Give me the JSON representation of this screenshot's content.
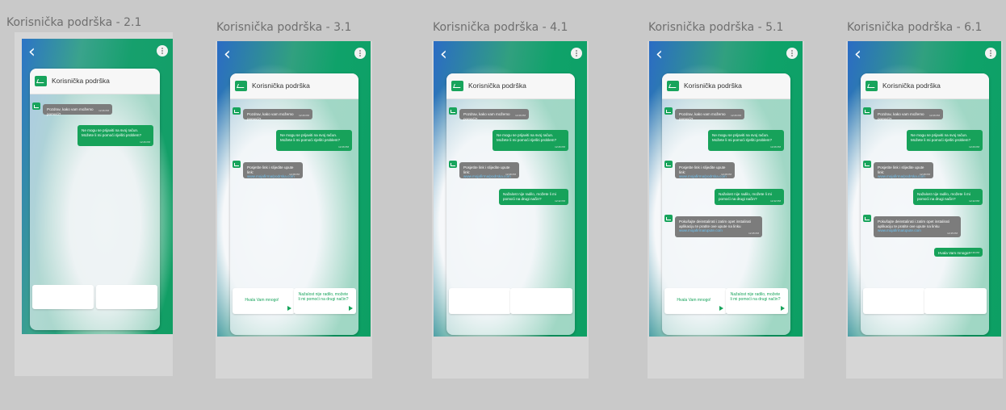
{
  "app": {
    "chat_title": "Korisnička podrška",
    "back_symbol": "‹",
    "nav_icons": [
      "home-icon",
      "walking-person-icon",
      "dog-icon",
      "pet-icon"
    ],
    "colors": {
      "accent_green": "#17a25a",
      "bot_gray": "#7c7c7c",
      "link_blue": "#6ec3f2",
      "canvas": "#c9c9c9"
    }
  },
  "frames": [
    {
      "title": "Korisnička podrška - 2.1",
      "messages": [
        {
          "from": "bot",
          "text": "Pozdrav, kako vam možemo pomoći?",
          "time": "12:26 PM"
        },
        {
          "from": "user",
          "text": "Ne mogu se prijaviti na svoj račun. Možete li mi pomoći riješiti problem?",
          "time": "12:26 PM"
        }
      ],
      "replies": [
        "",
        ""
      ]
    },
    {
      "title": "Korisnička podrška - 3.1",
      "messages": [
        {
          "from": "bot",
          "text": "Pozdrav, kako vam možemo pomoći?",
          "time": "12:26 PM"
        },
        {
          "from": "user",
          "text": "Ne mogu se prijaviti na svoj račun. Možete li mi pomoći riješiti problem?",
          "time": "12:26 PM"
        },
        {
          "from": "bot",
          "text": "Posjetite link i slijedite upute link:",
          "link": "www.mojafirma/podrska.com",
          "time": "12:28 PM"
        }
      ],
      "replies": [
        "Hvala Vam mnogo!",
        "Nažalost nije radilo, možete li mi pomoći na drugi način?"
      ]
    },
    {
      "title": "Korisnička podrška - 4.1",
      "messages": [
        {
          "from": "bot",
          "text": "Pozdrav, kako vam možemo pomoći?",
          "time": "12:26 PM"
        },
        {
          "from": "user",
          "text": "Ne mogu se prijaviti na svoj račun. Možete li mi pomoći riješiti problem?",
          "time": "12:26 PM"
        },
        {
          "from": "bot",
          "text": "Posjetite link i slijedite upute link:",
          "link": "www.mojafirma/podrska.com",
          "time": "12:28 PM"
        },
        {
          "from": "user",
          "text": "Nažalost nije radilo, možete li mi pomoći na drugi način?",
          "time": "12:42 PM"
        }
      ],
      "replies": [
        "",
        ""
      ]
    },
    {
      "title": "Korisnička podrška - 5.1",
      "messages": [
        {
          "from": "bot",
          "text": "Pozdrav, kako vam možemo pomoći?",
          "time": "12:26 PM"
        },
        {
          "from": "user",
          "text": "Ne mogu se prijaviti na svoj račun. Možete li mi pomoći riješiti problem?",
          "time": "12:26 PM"
        },
        {
          "from": "bot",
          "text": "Posjetite link i slijedite upute link:",
          "link": "www.mojafirma/podrska.com",
          "time": "12:28 PM"
        },
        {
          "from": "user",
          "text": "Nažalost nije radilo, možete li mi pomoći na drugi način?",
          "time": "12:42 PM"
        },
        {
          "from": "bot",
          "text": "Pokušajte deinstalirati i zatim opet instalirati aplikaciju te pratite ove upute na linku",
          "link": "www.mojafirma/upute.com",
          "time": "12:45 PM"
        }
      ],
      "replies": [
        "Hvala Vam mnogo!",
        "Nažalost nije radilo, možete li mi pomoći na drugi način?"
      ]
    },
    {
      "title": "Korisnička podrška - 6.1",
      "messages": [
        {
          "from": "bot",
          "text": "Pozdrav, kako vam možemo pomoći?",
          "time": "12:26 PM"
        },
        {
          "from": "user",
          "text": "Ne mogu se prijaviti na svoj račun. Možete li mi pomoći riješiti problem?",
          "time": "12:26 PM"
        },
        {
          "from": "bot",
          "text": "Posjetite link i slijedite upute link:",
          "link": "www.mojafirma/podrska.com",
          "time": "12:28 PM"
        },
        {
          "from": "user",
          "text": "Nažalost nije radilo, možete li mi pomoći na drugi način?",
          "time": "12:42 PM"
        },
        {
          "from": "bot",
          "text": "Pokušajte deinstalirati i zatim opet instalirati aplikaciju te pratite ove upute na linku",
          "link": "www.mojafirma/upute.com",
          "time": "12:45 PM"
        },
        {
          "from": "user",
          "text": "Hvala Vam mnogo!",
          "time": "12:46 PM"
        }
      ],
      "replies": [
        "",
        ""
      ]
    }
  ]
}
